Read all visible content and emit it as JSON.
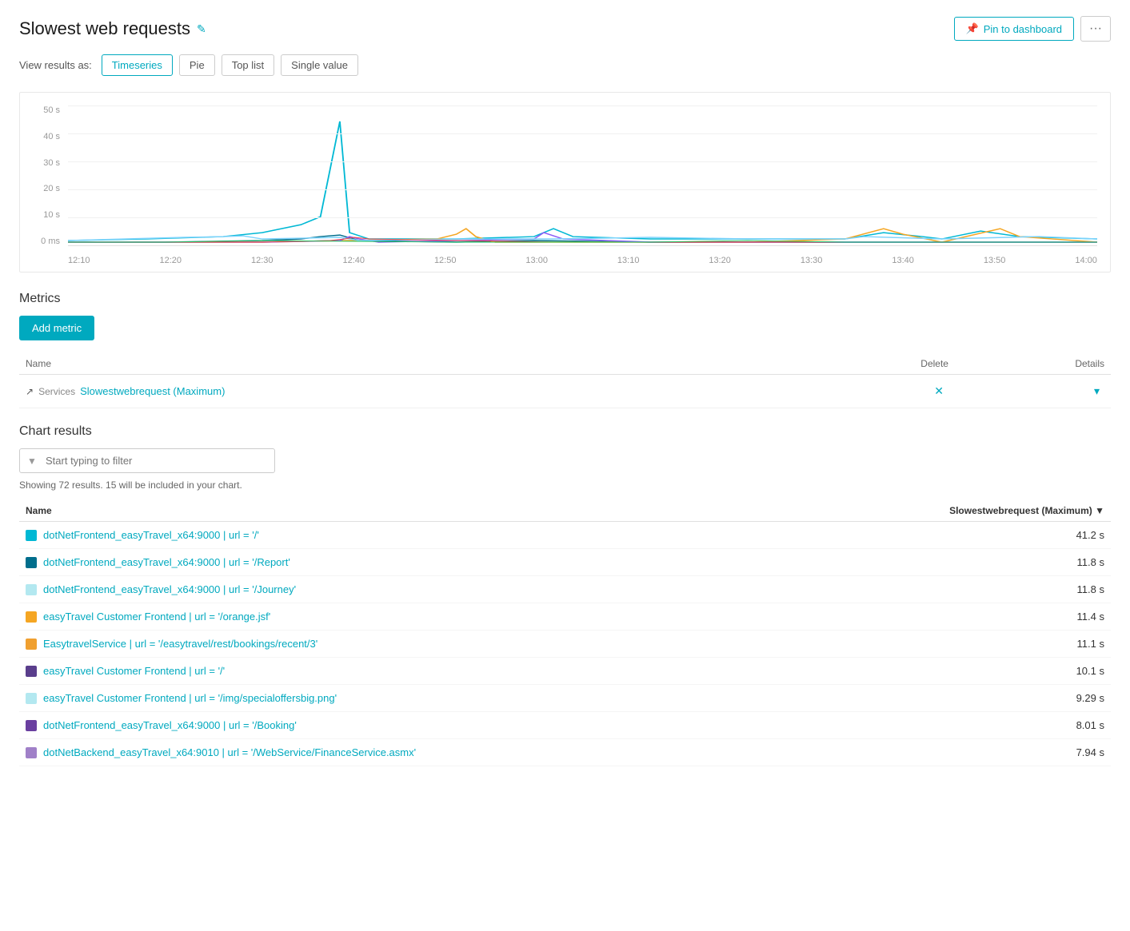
{
  "page": {
    "title": "Slowest web requests",
    "edit_icon": "✎"
  },
  "header_actions": {
    "pin_label": "Pin to dashboard",
    "more_label": "···"
  },
  "view_toggle": {
    "label": "View results as:",
    "options": [
      {
        "id": "timeseries",
        "label": "Timeseries",
        "active": true
      },
      {
        "id": "pie",
        "label": "Pie",
        "active": false
      },
      {
        "id": "toplist",
        "label": "Top list",
        "active": false
      },
      {
        "id": "single",
        "label": "Single value",
        "active": false
      }
    ]
  },
  "chart": {
    "y_labels": [
      "50 s",
      "40 s",
      "30 s",
      "20 s",
      "10 s",
      "0 ms"
    ],
    "x_labels": [
      "12:10",
      "12:20",
      "12:30",
      "12:40",
      "12:50",
      "13:00",
      "13:10",
      "13:20",
      "13:30",
      "13:40",
      "13:50",
      "14:00"
    ]
  },
  "metrics_section": {
    "title": "Metrics",
    "add_btn_label": "Add metric",
    "table_headers": {
      "name": "Name",
      "delete": "Delete",
      "details": "Details"
    },
    "rows": [
      {
        "icon": "↗",
        "tag": "Services",
        "value": "Slowestwebrequest (Maximum)"
      }
    ]
  },
  "chart_results": {
    "title": "Chart results",
    "filter_placeholder": "Start typing to filter",
    "results_info": "Showing 72 results. 15 will be included in your chart.",
    "table_headers": {
      "name": "Name",
      "sort_col": "Slowestwebrequest (Maximum) ▼"
    },
    "rows": [
      {
        "color": "#00b8d4",
        "color_style": "solid",
        "name": "dotNetFrontend_easyTravel_x64:9000 | url = '/'",
        "value": "41.2 s"
      },
      {
        "color": "#006e8c",
        "color_style": "solid",
        "name": "dotNetFrontend_easyTravel_x64:9000 | url = '/Report'",
        "value": "11.8 s"
      },
      {
        "color": "#b3e8f0",
        "color_style": "solid",
        "name": "dotNetFrontend_easyTravel_x64:9000 | url = '/Journey'",
        "value": "11.8 s"
      },
      {
        "color": "#f5a623",
        "color_style": "solid",
        "name": "easyTravel Customer Frontend | url = '/orange.jsf'",
        "value": "11.4 s"
      },
      {
        "color": "#f0a030",
        "color_style": "solid",
        "name": "EasytravelService | url = '/easytravel/rest/bookings/recent/3'",
        "value": "11.1 s"
      },
      {
        "color": "#5a3e8c",
        "color_style": "solid",
        "name": "easyTravel Customer Frontend | url = '/'",
        "value": "10.1 s"
      },
      {
        "color": "#b3e8f0",
        "color_style": "solid",
        "name": "easyTravel Customer Frontend | url = '/img/specialoffersbig.png'",
        "value": "9.29 s"
      },
      {
        "color": "#6a3fa0",
        "color_style": "solid",
        "name": "dotNetFrontend_easyTravel_x64:9000 | url = '/Booking'",
        "value": "8.01 s"
      },
      {
        "color": "#a080c8",
        "color_style": "solid",
        "name": "dotNetBackend_easyTravel_x64:9010 | url = '/WebService/FinanceService.asmx'",
        "value": "7.94 s"
      }
    ]
  }
}
